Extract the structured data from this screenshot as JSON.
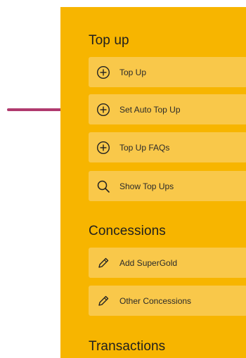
{
  "sections": {
    "top_up": {
      "title": "Top up",
      "items": [
        {
          "label": "Top Up",
          "icon": "plus-circle-icon"
        },
        {
          "label": "Set Auto Top Up",
          "icon": "plus-circle-icon"
        },
        {
          "label": "Top Up FAQs",
          "icon": "plus-circle-icon"
        },
        {
          "label": "Show Top Ups",
          "icon": "search-icon"
        }
      ]
    },
    "concessions": {
      "title": "Concessions",
      "items": [
        {
          "label": "Add SuperGold",
          "icon": "pencil-icon"
        },
        {
          "label": "Other Concessions",
          "icon": "pencil-icon"
        }
      ]
    },
    "transactions": {
      "title": "Transactions"
    }
  },
  "colors": {
    "panel_bg": "#f7b500",
    "item_bg": "#f9c84a",
    "arrow": "#b03a6e",
    "text": "#1f1f1f"
  }
}
